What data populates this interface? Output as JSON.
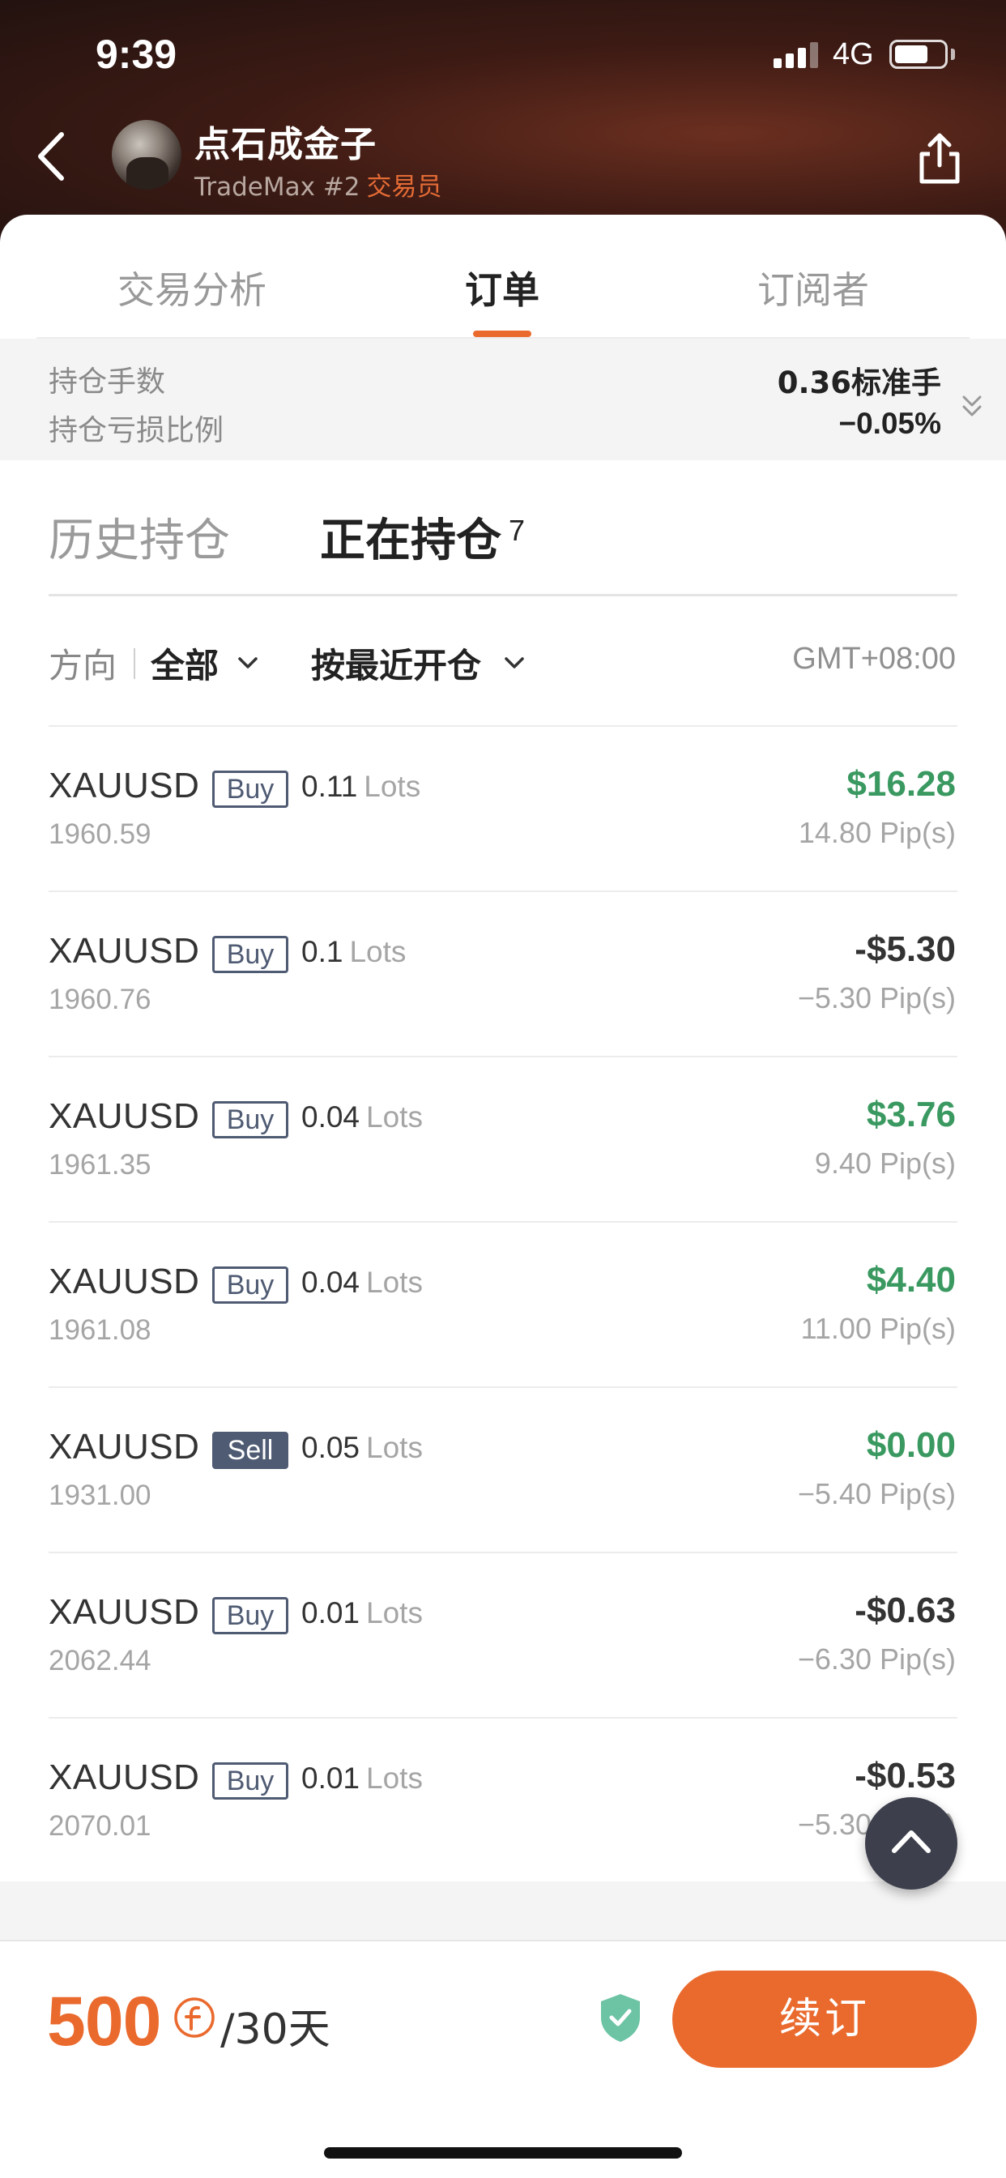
{
  "status_bar": {
    "time": "9:39",
    "network": "4G"
  },
  "profile": {
    "name": "点石成金子",
    "rank": "TradeMax #2",
    "role": "交易员"
  },
  "tabs": [
    {
      "label": "交易分析",
      "active": false
    },
    {
      "label": "订单",
      "active": true
    },
    {
      "label": "订阅者",
      "active": false
    }
  ],
  "summary": {
    "lots_label": "持仓手数",
    "lots_value": "0.36标准手",
    "loss_label": "持仓亏损比例",
    "loss_value": "−0.05%"
  },
  "subtabs": {
    "history": "历史持仓",
    "open": "正在持仓",
    "open_count": "7"
  },
  "filters": {
    "direction_label": "方向",
    "direction_value": "全部",
    "sort_value": "按最近开仓",
    "timezone": "GMT+08:00"
  },
  "orders": [
    {
      "symbol": "XAUUSD",
      "side": "Buy",
      "lots": "0.11",
      "lots_unit": "Lots",
      "price": "1960.59",
      "pl": "$16.28",
      "pips": "14.80 Pip(s)",
      "pl_color": "#3a9960"
    },
    {
      "symbol": "XAUUSD",
      "side": "Buy",
      "lots": "0.1",
      "lots_unit": "Lots",
      "price": "1960.76",
      "pl": "-$5.30",
      "pips": "−5.30 Pip(s)",
      "pl_color": "#333333"
    },
    {
      "symbol": "XAUUSD",
      "side": "Buy",
      "lots": "0.04",
      "lots_unit": "Lots",
      "price": "1961.35",
      "pl": "$3.76",
      "pips": "9.40 Pip(s)",
      "pl_color": "#3a9960"
    },
    {
      "symbol": "XAUUSD",
      "side": "Buy",
      "lots": "0.04",
      "lots_unit": "Lots",
      "price": "1961.08",
      "pl": "$4.40",
      "pips": "11.00 Pip(s)",
      "pl_color": "#3a9960"
    },
    {
      "symbol": "XAUUSD",
      "side": "Sell",
      "lots": "0.05",
      "lots_unit": "Lots",
      "price": "1931.00",
      "pl": "$0.00",
      "pips": "−5.40 Pip(s)",
      "pl_color": "#3a9960"
    },
    {
      "symbol": "XAUUSD",
      "side": "Buy",
      "lots": "0.01",
      "lots_unit": "Lots",
      "price": "2062.44",
      "pl": "-$0.63",
      "pips": "−6.30 Pip(s)",
      "pl_color": "#333333"
    },
    {
      "symbol": "XAUUSD",
      "side": "Buy",
      "lots": "0.01",
      "lots_unit": "Lots",
      "price": "2070.01",
      "pl": "-$0.53",
      "pips": "−5.30 Pip(s)",
      "pl_color": "#333333"
    }
  ],
  "subscription": {
    "price": "500",
    "period": "/30天",
    "renew_label": "续订"
  },
  "colors": {
    "accent": "#ea6a2e",
    "profit": "#3a9960",
    "side_badge": "#4f5b73"
  }
}
